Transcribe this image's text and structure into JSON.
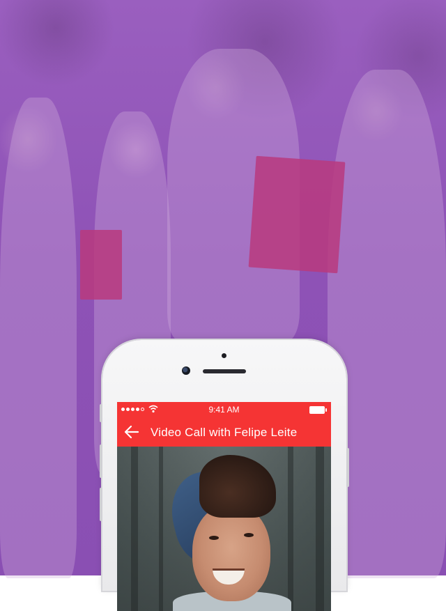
{
  "status_bar": {
    "time": "9:41 AM"
  },
  "app_bar": {
    "title": "Video Call with Felipe Leite"
  },
  "icons": {
    "back": "arrow-left-icon",
    "wifi": "wifi-icon",
    "battery": "battery-icon",
    "signal": "signal-icon"
  },
  "colors": {
    "accent": "#f53434",
    "background_overlay": "#8e52b6"
  }
}
